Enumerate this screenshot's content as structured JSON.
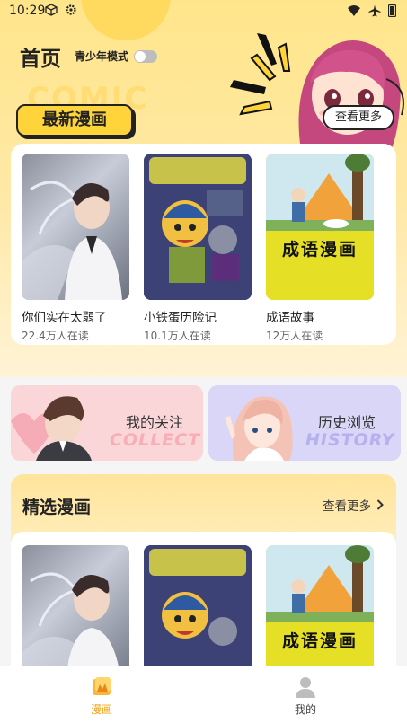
{
  "status": {
    "time": "10:29",
    "icons": [
      "cube-icon",
      "gear-icon",
      "wifi-icon",
      "airplane-icon",
      "battery-icon"
    ]
  },
  "header": {
    "title": "首页",
    "teen_mode_label": "青少年模式",
    "teen_mode_on": false,
    "comic_watermark": "COMIC",
    "see_more_bubble": "查看更多"
  },
  "latest": {
    "tag": "最新漫画",
    "items": [
      {
        "title": "你们实在太弱了",
        "reads": "22.4万人在读"
      },
      {
        "title": "小铁蛋历险记",
        "reads": "10.1万人在读"
      },
      {
        "title": "成语故事",
        "reads": "12万人在读"
      }
    ],
    "cover_c_text": "成语漫画"
  },
  "shortcuts": {
    "follow": {
      "label": "我的关注",
      "bg_text": "COLLECT"
    },
    "history": {
      "label": "历史浏览",
      "bg_text": "HISTORY"
    }
  },
  "featured": {
    "title": "精选漫画",
    "more": "查看更多",
    "cover_c_text": "成语漫画"
  },
  "nav": {
    "home": "漫画",
    "mine": "我的"
  },
  "colors": {
    "accent": "#ffd33a",
    "nav_active": "#f3a51b"
  }
}
